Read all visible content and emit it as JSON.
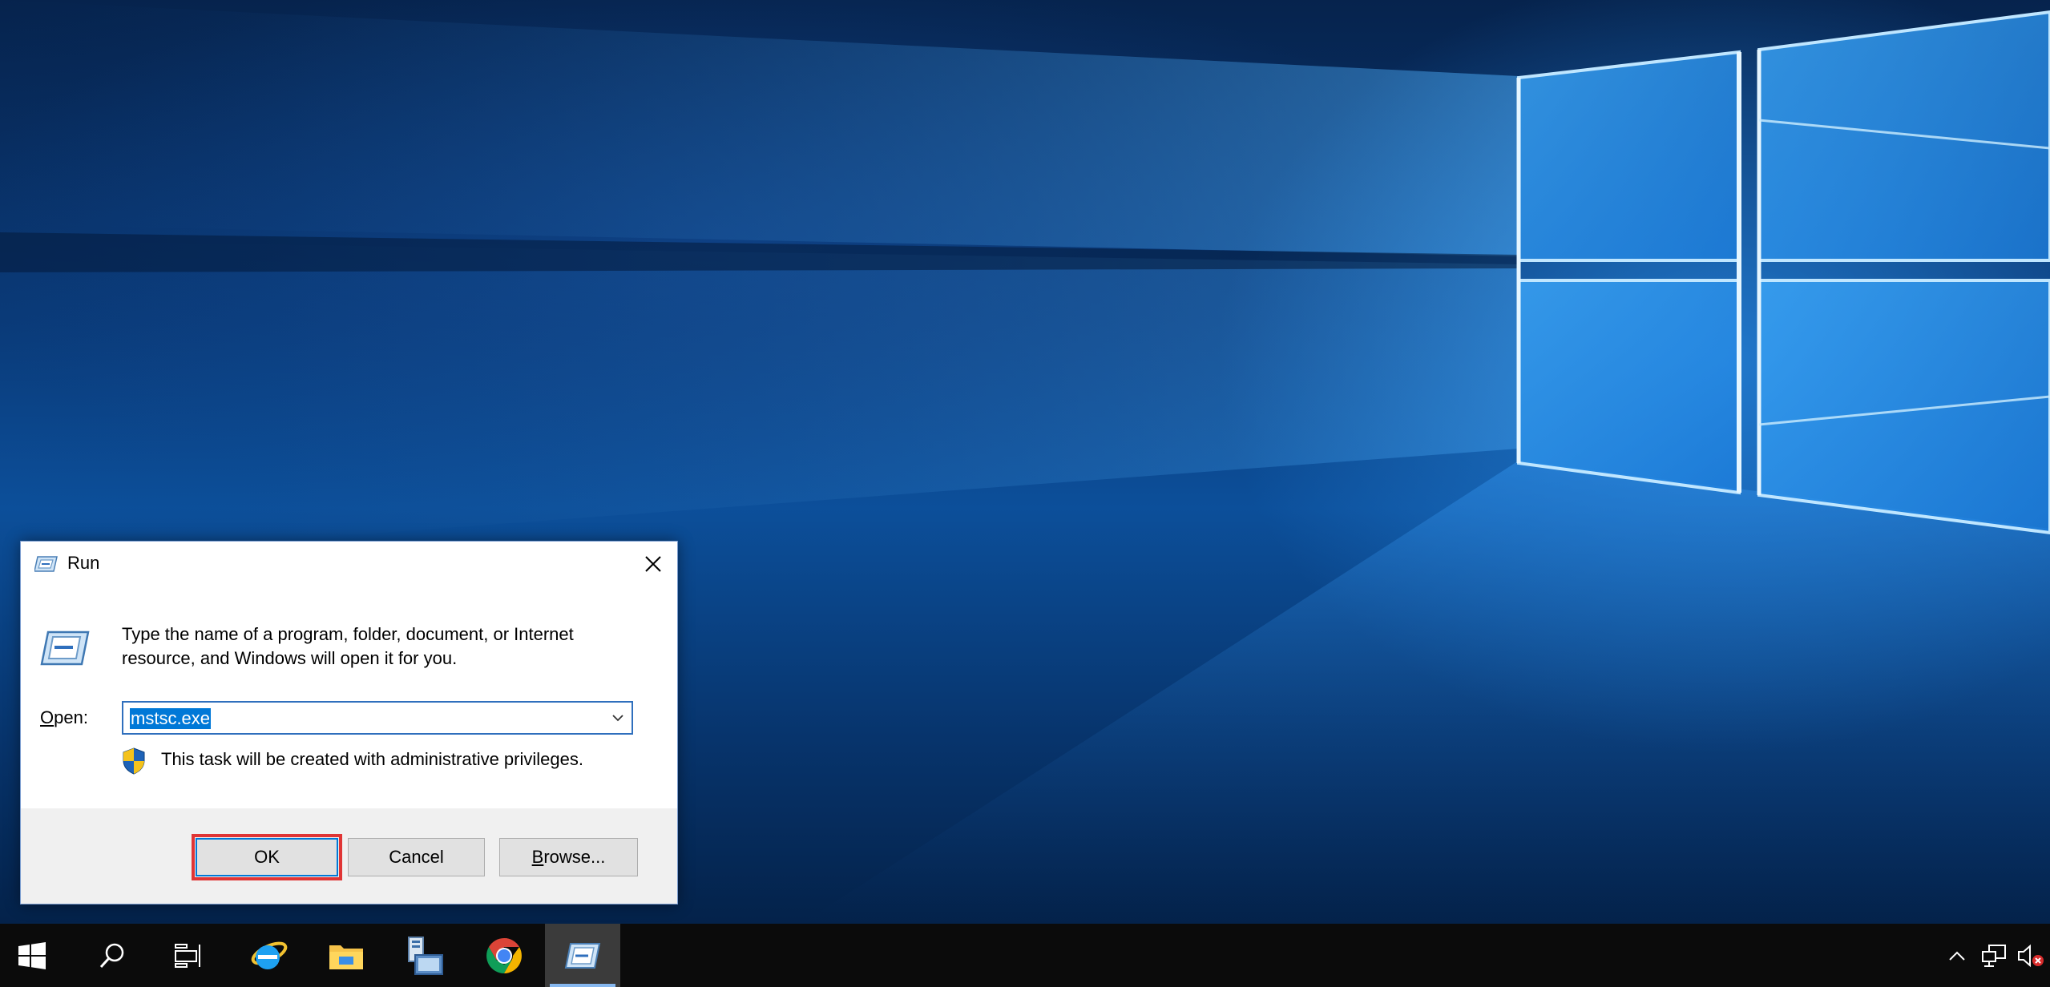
{
  "desktop": {
    "wallpaper": "windows-10-hero",
    "accent_color": "#0078d7"
  },
  "run_dialog": {
    "title": "Run",
    "description": "Type the name of a program, folder, document, or Internet resource, and Windows will open it for you.",
    "open_label_accel": "O",
    "open_label_rest": "pen:",
    "open_value": "mstsc.exe",
    "admin_note": "This task will be created with administrative privileges.",
    "ok_label": "OK",
    "cancel_label": "Cancel",
    "browse_label_accel": "B",
    "browse_label_rest": "rowse...",
    "highlight_color": "#e03535"
  },
  "taskbar": {
    "items": [
      {
        "icon": "windows-start-icon"
      },
      {
        "icon": "search-icon"
      },
      {
        "icon": "task-view-icon"
      },
      {
        "icon": "internet-explorer-icon"
      },
      {
        "icon": "file-explorer-icon"
      },
      {
        "icon": "server-manager-icon"
      },
      {
        "icon": "chrome-icon"
      },
      {
        "icon": "run-app-icon",
        "active": true
      }
    ],
    "tray": [
      {
        "icon": "chevron-up-icon"
      },
      {
        "icon": "network-icon"
      },
      {
        "icon": "volume-muted-icon"
      }
    ]
  }
}
